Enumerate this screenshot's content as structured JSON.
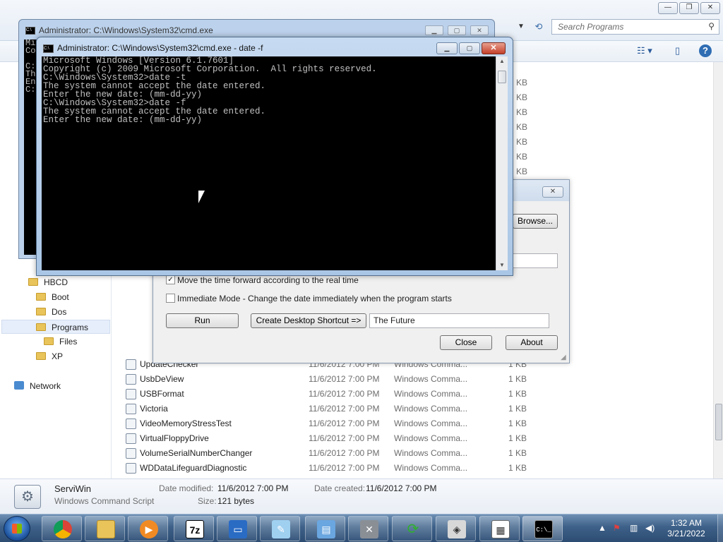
{
  "explorer": {
    "search_placeholder": "Search Programs",
    "window_buttons": [
      "—",
      "❐",
      "✕"
    ],
    "sidebar": [
      {
        "label": "HBCD"
      },
      {
        "label": "Boot"
      },
      {
        "label": "Dos"
      },
      {
        "label": "Programs",
        "selected": true
      },
      {
        "label": "Files"
      },
      {
        "label": "XP"
      },
      {
        "label": "Network"
      }
    ],
    "files": [
      {
        "name": "UpdateChecker",
        "date": "11/6/2012 7:00 PM",
        "type": "Windows Comma...",
        "size": "1 KB"
      },
      {
        "name": "UsbDeView",
        "date": "11/6/2012 7:00 PM",
        "type": "Windows Comma...",
        "size": "1 KB"
      },
      {
        "name": "USBFormat",
        "date": "11/6/2012 7:00 PM",
        "type": "Windows Comma...",
        "size": "1 KB"
      },
      {
        "name": "Victoria",
        "date": "11/6/2012 7:00 PM",
        "type": "Windows Comma...",
        "size": "1 KB"
      },
      {
        "name": "VideoMemoryStressTest",
        "date": "11/6/2012 7:00 PM",
        "type": "Windows Comma...",
        "size": "1 KB"
      },
      {
        "name": "VirtualFloppyDrive",
        "date": "11/6/2012 7:00 PM",
        "type": "Windows Comma...",
        "size": "1 KB"
      },
      {
        "name": "VolumeSerialNumberChanger",
        "date": "11/6/2012 7:00 PM",
        "type": "Windows Comma...",
        "size": "1 KB"
      },
      {
        "name": "WDDataLifeguardDiagnostic",
        "date": "11/6/2012 7:00 PM",
        "type": "Windows Comma...",
        "size": "1 KB"
      }
    ],
    "partial_sizes": [
      "KB",
      "KB",
      "KB",
      "KB",
      "KB",
      "KB",
      "KB"
    ],
    "details": {
      "name": "ServiWin",
      "type": "Windows Command Script",
      "modified_label": "Date modified:",
      "modified_value": "11/6/2012 7:00 PM",
      "created_label": "Date created:",
      "created_value": "11/6/2012 7:00 PM",
      "size_label": "Size:",
      "size_value": "121 bytes"
    }
  },
  "cmd_back": {
    "title": "Administrator: C:\\Windows\\System32\\cmd.exe",
    "visible_chars": "Mi\nCo\n\nC:\nTh\nEn\nC:"
  },
  "cmd_front": {
    "title": "Administrator: C:\\Windows\\System32\\cmd.exe - date  -f",
    "lines": [
      "Microsoft Windows [Version 6.1.7601]",
      "Copyright (c) 2009 Microsoft Corporation.  All rights reserved.",
      "",
      "C:\\Windows\\System32>date -t",
      "The system cannot accept the date entered.",
      "Enter the new date: (mm-dd-yy)",
      "C:\\Windows\\System32>date -f",
      "The system cannot accept the date entered.",
      "Enter the new date: (mm-dd-yy)"
    ]
  },
  "dialog": {
    "browse_label": "Browse...",
    "checkbox_move": {
      "label": "Move the time forward according to the real time",
      "checked": true
    },
    "checkbox_immediate": {
      "label": "Immediate Mode - Change the date immediately when the program starts",
      "checked": false
    },
    "run_label": "Run",
    "shortcut_label": "Create Desktop Shortcut =>",
    "shortcut_name": "The Future",
    "close_label": "Close",
    "about_label": "About"
  },
  "taskbar": {
    "apps": [
      "chrome-icon",
      "explorer-icon",
      "media-player-icon",
      "7zip-icon",
      "monitor-icon",
      "notepad-icon",
      "control-panel-icon",
      "tools-icon",
      "sync-icon",
      "disk-icon",
      "calendar-icon",
      "cmd-icon"
    ],
    "app_7z_label": "7z",
    "app_cmd_label": "C:\\_",
    "time": "1:32 AM",
    "date": "3/21/2022"
  }
}
